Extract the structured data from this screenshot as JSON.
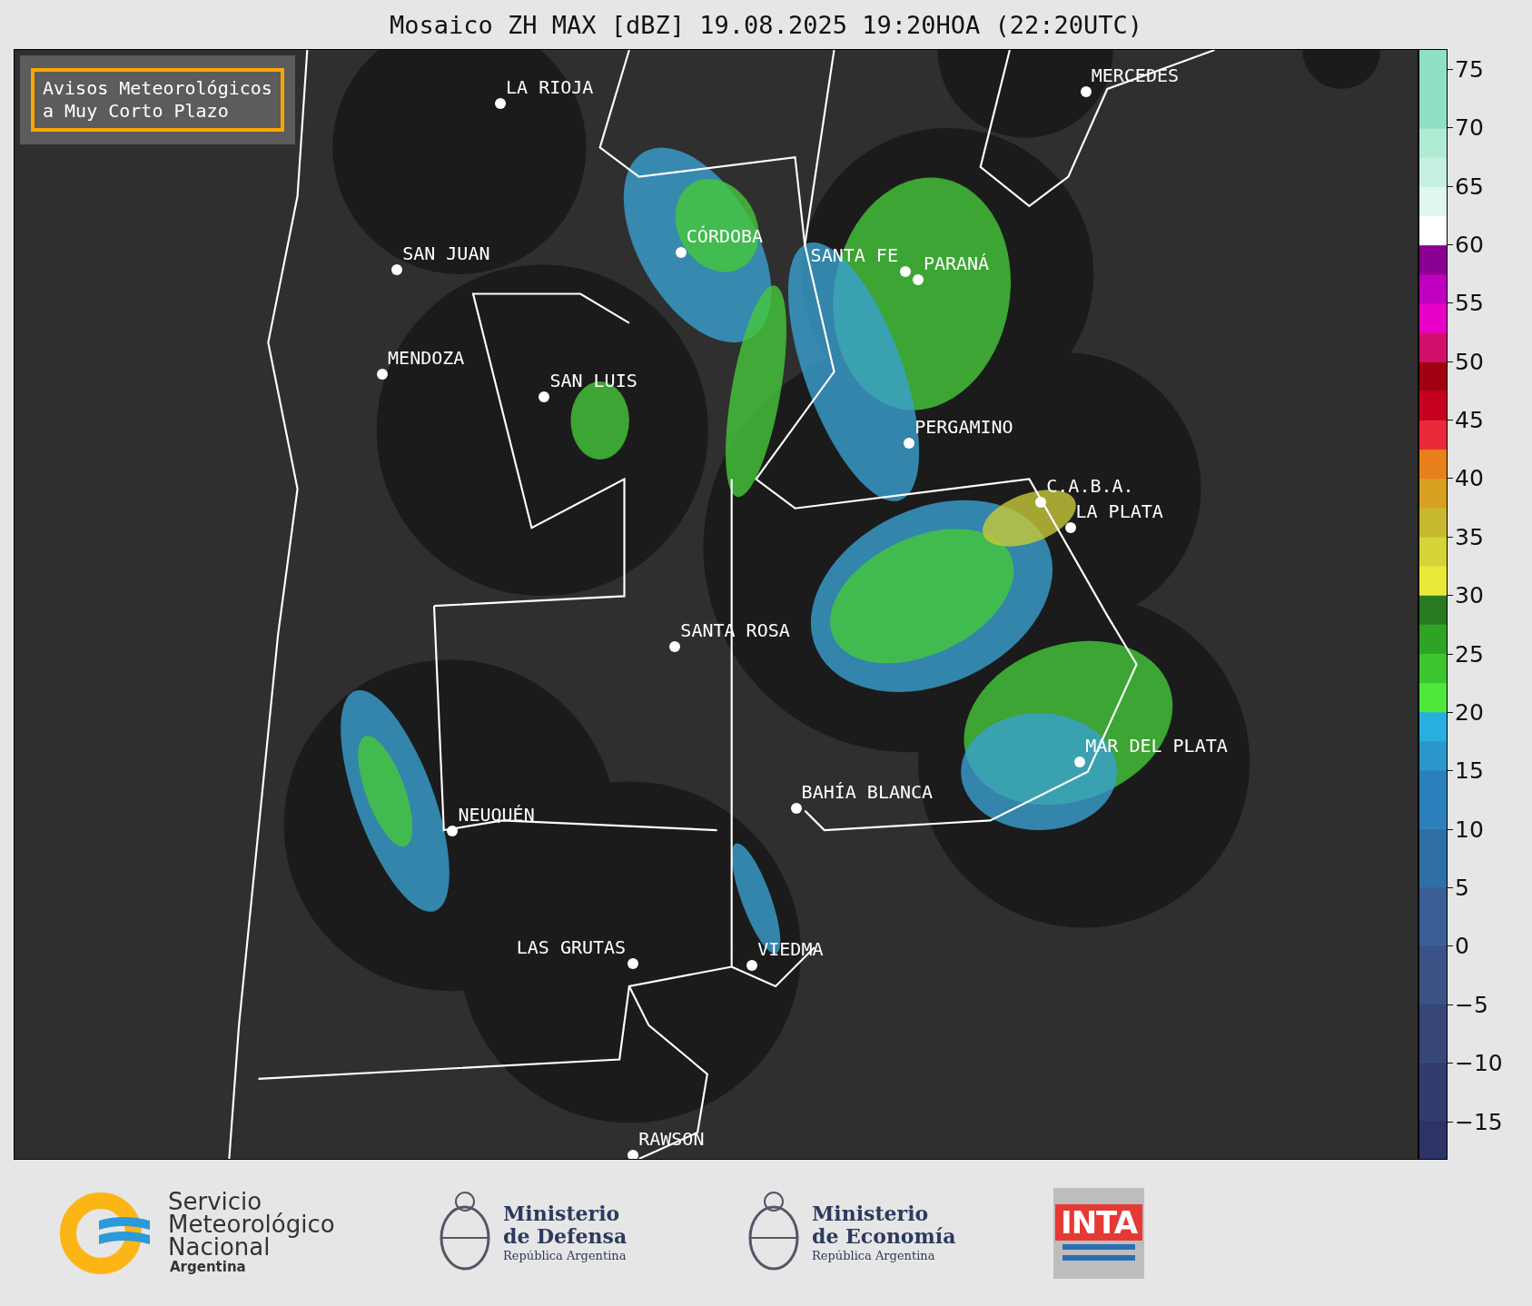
{
  "title": "Mosaico ZH MAX [dBZ] 19.08.2025 19:20HOA (22:20UTC)",
  "warning_label": [
    "Avisos Meteorológicos",
    "a Muy Corto Plazo"
  ],
  "cities": [
    {
      "name": "LA RIOJA"
    },
    {
      "name": "MERCEDES"
    },
    {
      "name": "CÓRDOBA"
    },
    {
      "name": "SAN JUAN"
    },
    {
      "name": "SANTA FE"
    },
    {
      "name": "PARANÁ"
    },
    {
      "name": "MENDOZA"
    },
    {
      "name": "SAN LUIS"
    },
    {
      "name": "PERGAMINO"
    },
    {
      "name": "C.A.B.A."
    },
    {
      "name": "LA PLATA"
    },
    {
      "name": "SANTA ROSA"
    },
    {
      "name": "MAR DEL PLATA"
    },
    {
      "name": "BAHÍA BLANCA"
    },
    {
      "name": "NEUQUÉN"
    },
    {
      "name": "LAS GRUTAS"
    },
    {
      "name": "VIEDMA"
    },
    {
      "name": "RAWSON"
    }
  ],
  "colorbar": {
    "ticks": [
      "75",
      "70",
      "65",
      "60",
      "55",
      "50",
      "45",
      "40",
      "35",
      "30",
      "25",
      "20",
      "15",
      "10",
      "5",
      "0",
      "−5",
      "−10",
      "−15"
    ]
  },
  "footer": {
    "smn": [
      "Servicio",
      "Meteorológico",
      "Nacional",
      "Argentina"
    ],
    "defensa": [
      "Ministerio",
      "de Defensa",
      "República Argentina"
    ],
    "economia": [
      "Ministerio",
      "de Economía",
      "República Argentina"
    ],
    "inta": "INTA"
  }
}
